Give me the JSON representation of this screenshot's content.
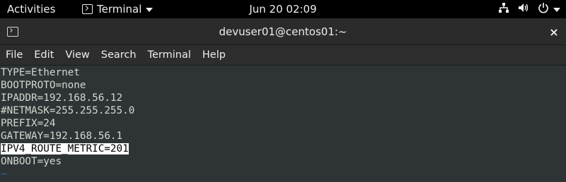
{
  "topbar": {
    "activities": "Activities",
    "app_name": "Terminal",
    "clock": "Jun 20  02:09",
    "icons": [
      "network-icon",
      "volume-icon",
      "power-icon"
    ]
  },
  "window": {
    "title": "devuser01@centos01:~",
    "close_label": "×"
  },
  "menubar": {
    "items": [
      "File",
      "Edit",
      "View",
      "Search",
      "Terminal",
      "Help"
    ]
  },
  "terminal": {
    "lines": [
      "TYPE=Ethernet",
      "BOOTPROTO=none",
      "IPADDR=192.168.56.12",
      "#NETMASK=255.255.255.0",
      "PREFIX=24",
      "GATEWAY=192.168.56.1",
      "IPV4_ROUTE_METRIC=201",
      "ONBOOT=yes",
      "~"
    ],
    "highlighted_line_index": 6
  },
  "colors": {
    "terminal_bg": "#2e3436",
    "terminal_fg": "#d3d7cf",
    "tilde": "#3465a4"
  }
}
